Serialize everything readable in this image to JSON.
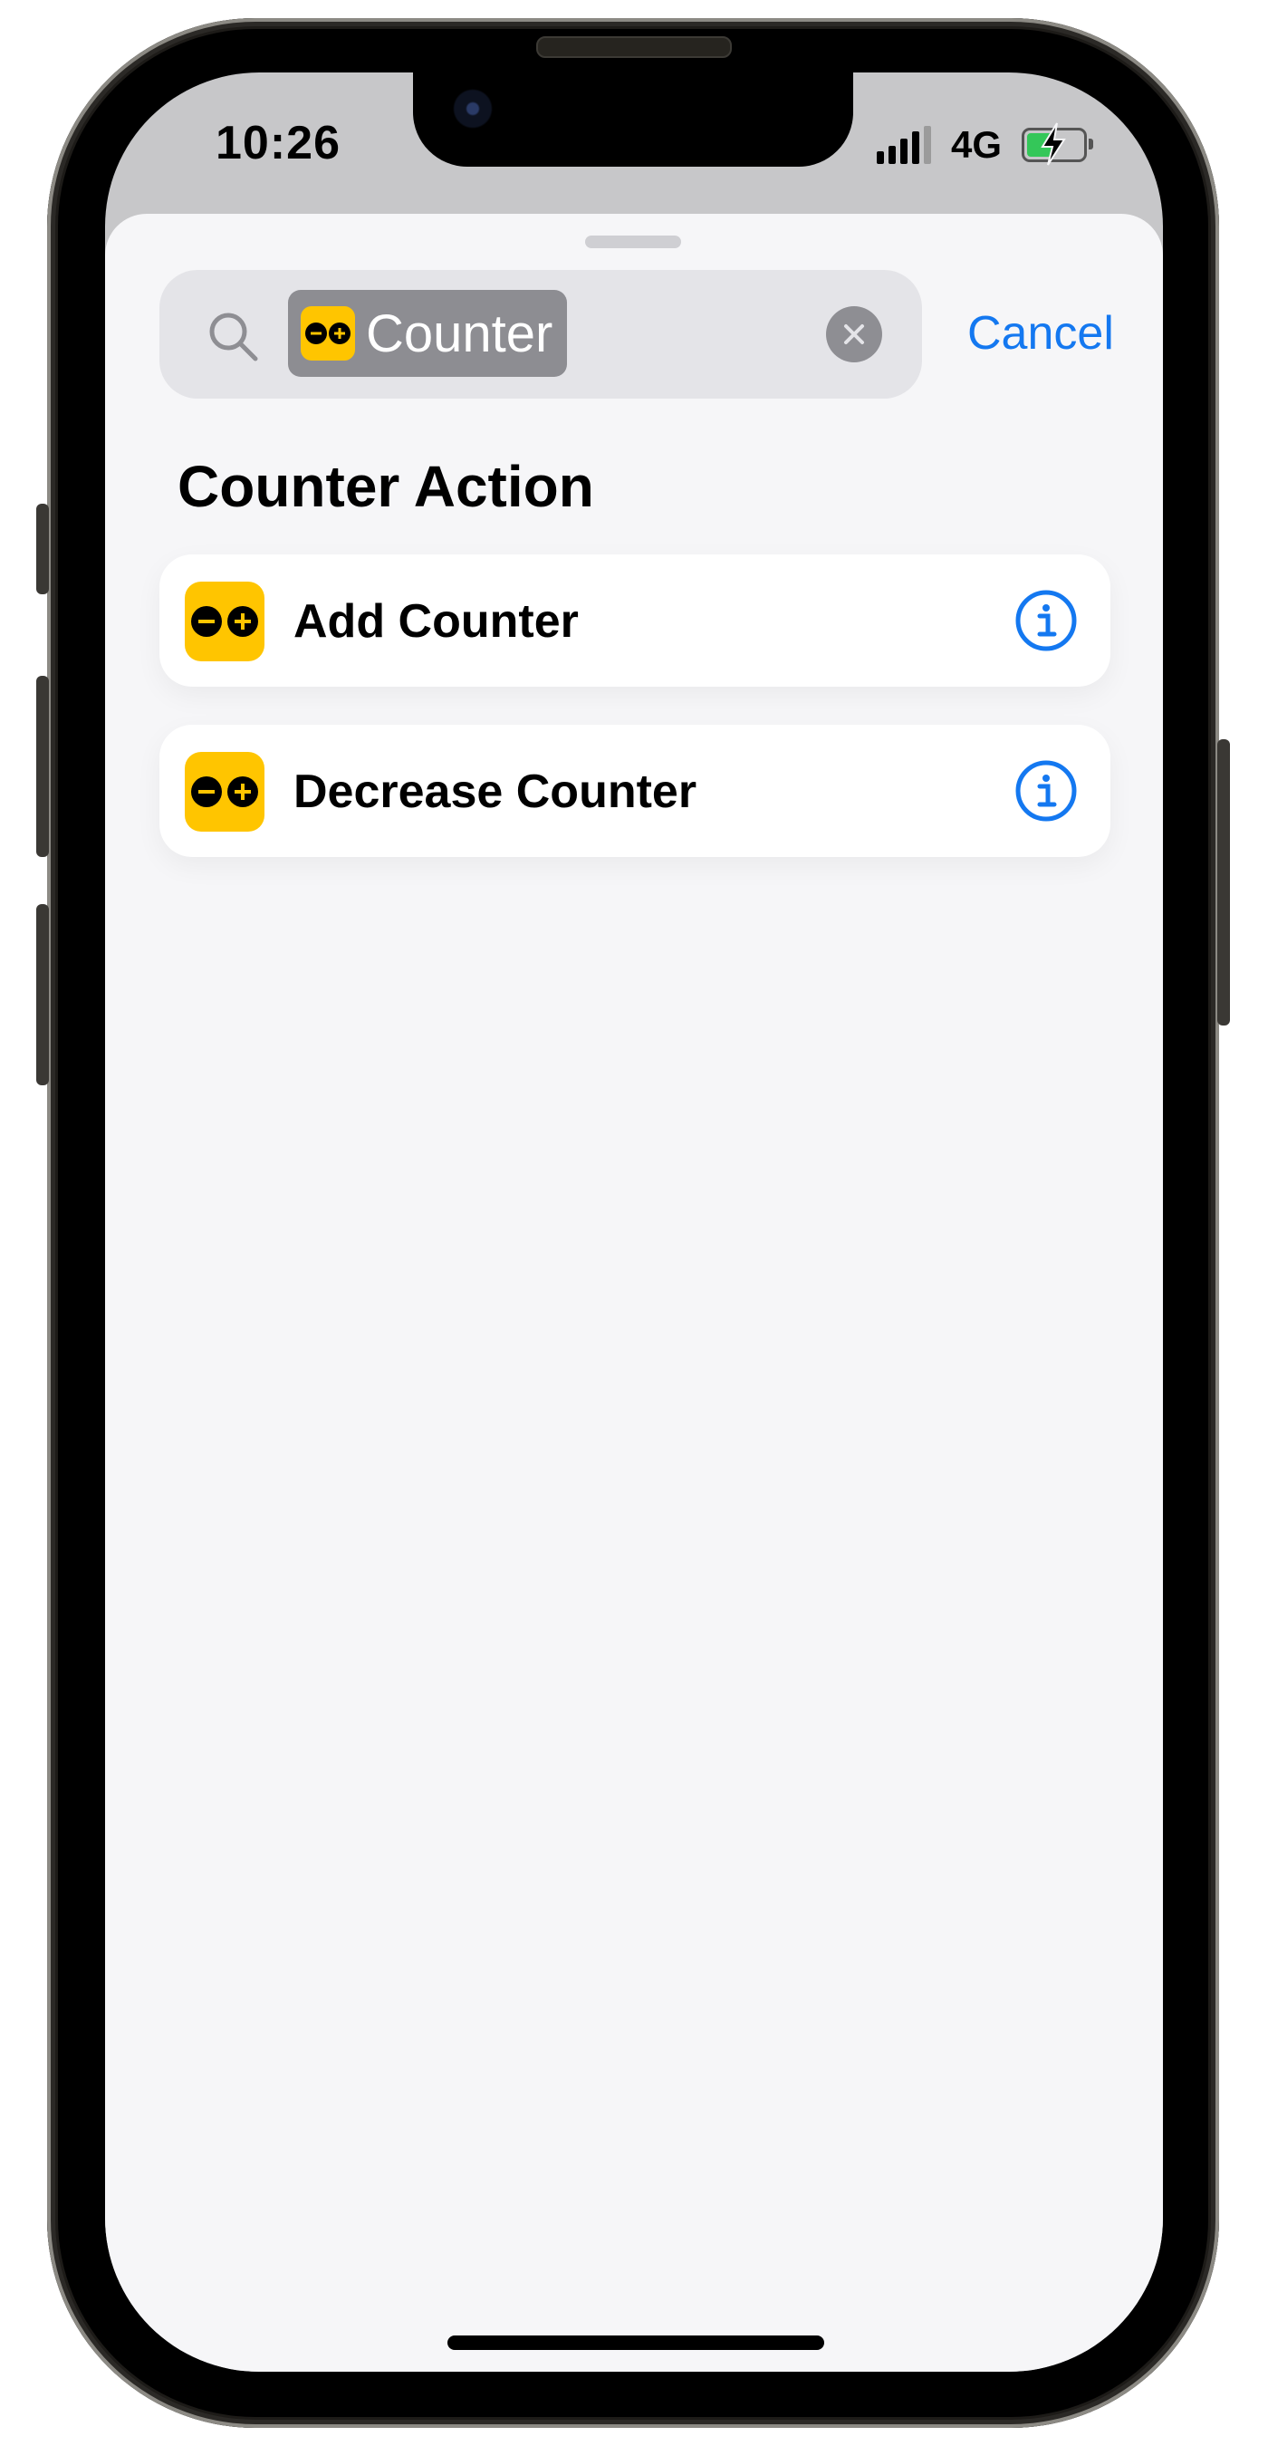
{
  "status_bar": {
    "time": "10:26",
    "network": "4G",
    "battery_color": "#34c759"
  },
  "search": {
    "icon": "search-icon",
    "token_label": "Counter",
    "token_icon": "counter-app-icon",
    "clear_icon": "clear-icon"
  },
  "cancel_label": "Cancel",
  "section_title": "Counter Action",
  "actions": [
    {
      "label": "Add Counter",
      "icon": "counter-app-icon",
      "info_icon": "info-icon"
    },
    {
      "label": "Decrease Counter",
      "icon": "counter-app-icon",
      "info_icon": "info-icon"
    }
  ],
  "colors": {
    "accent": "#1478f0",
    "app_icon": "#ffc500",
    "sheet": "#f6f6f8"
  }
}
